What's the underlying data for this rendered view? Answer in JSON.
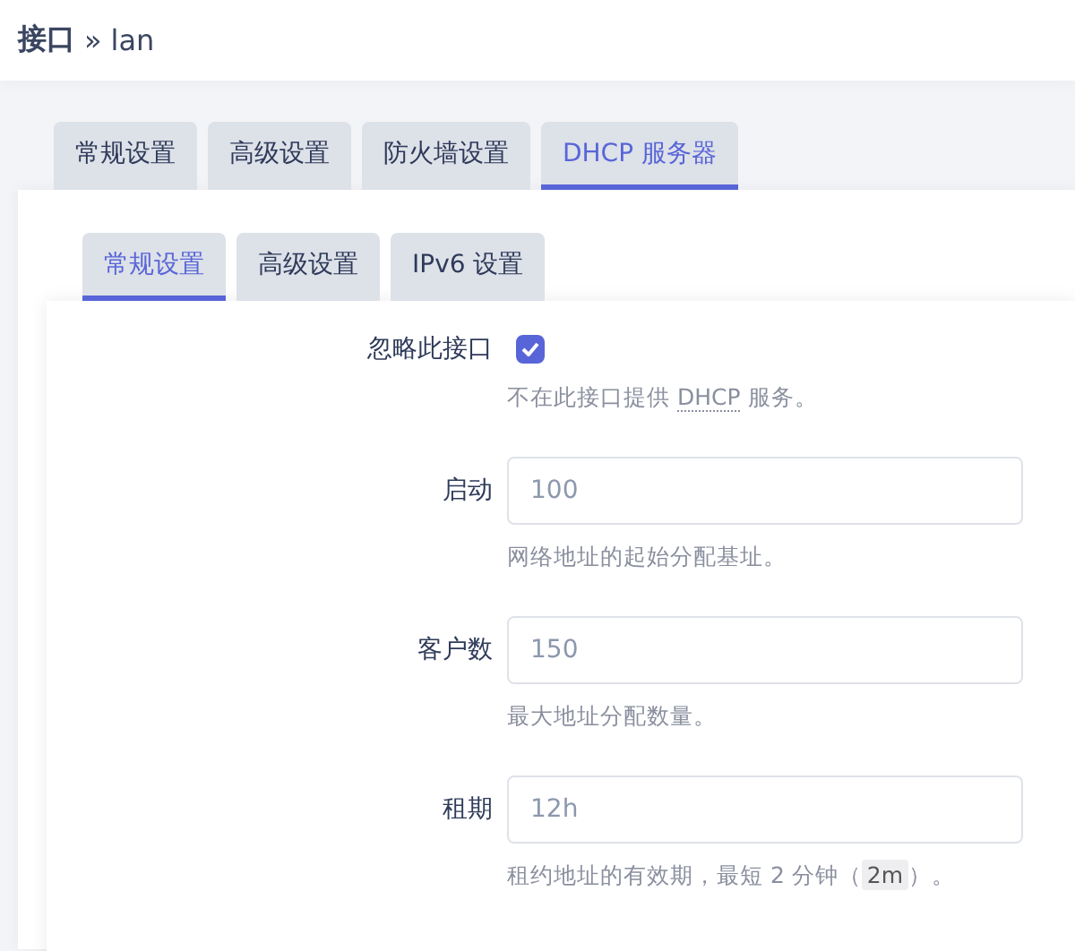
{
  "breadcrumb": {
    "section": "接口",
    "separator": "»",
    "current": "lan"
  },
  "tabs": [
    {
      "label": "常规设置",
      "selected": false
    },
    {
      "label": "高级设置",
      "selected": false
    },
    {
      "label": "防火墙设置",
      "selected": false
    },
    {
      "label": "DHCP 服务器",
      "selected": true
    }
  ],
  "subtabs": [
    {
      "label": "常规设置",
      "selected": true
    },
    {
      "label": "高级设置",
      "selected": false
    },
    {
      "label": "IPv6 设置",
      "selected": false
    }
  ],
  "fields": [
    {
      "kind": "checkbox",
      "label": "忽略此接口",
      "checked": true,
      "description": [
        {
          "kind": "text",
          "text": "不在此接口提供 "
        },
        {
          "kind": "abbr",
          "text": "DHCP"
        },
        {
          "kind": "text",
          "text": " 服务。"
        }
      ]
    },
    {
      "kind": "input",
      "label": "启动",
      "placeholder": "100",
      "description": [
        {
          "kind": "text",
          "text": "网络地址的起始分配基址。"
        }
      ]
    },
    {
      "kind": "input",
      "label": "客户数",
      "placeholder": "150",
      "description": [
        {
          "kind": "text",
          "text": "最大地址分配数量。"
        }
      ]
    },
    {
      "kind": "input",
      "label": "租期",
      "placeholder": "12h",
      "description": [
        {
          "kind": "text",
          "text": "租约地址的有效期，最短 2 分钟（"
        },
        {
          "kind": "code",
          "text": "2m"
        },
        {
          "kind": "text",
          "text": "）。"
        }
      ]
    }
  ]
}
